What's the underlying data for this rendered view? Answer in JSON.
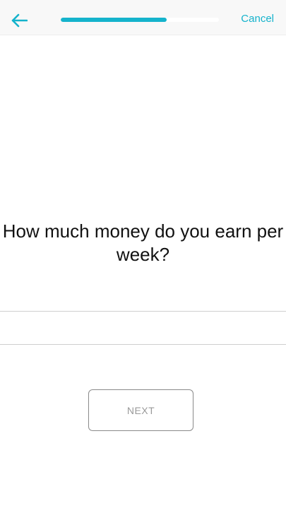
{
  "header": {
    "back_icon": "arrow-left-icon",
    "progress_fraction": 0.67,
    "cancel_label": "Cancel"
  },
  "question": {
    "text": "How much money do you earn per week?"
  },
  "answer": {
    "value": "",
    "placeholder": ""
  },
  "next_button": {
    "label": "NEXT"
  },
  "colors": {
    "accent": "#15b3cc",
    "text": "#111111",
    "button_border": "#8a8a8a",
    "button_text": "#9a9a9a",
    "divider": "#cfcfcf"
  }
}
